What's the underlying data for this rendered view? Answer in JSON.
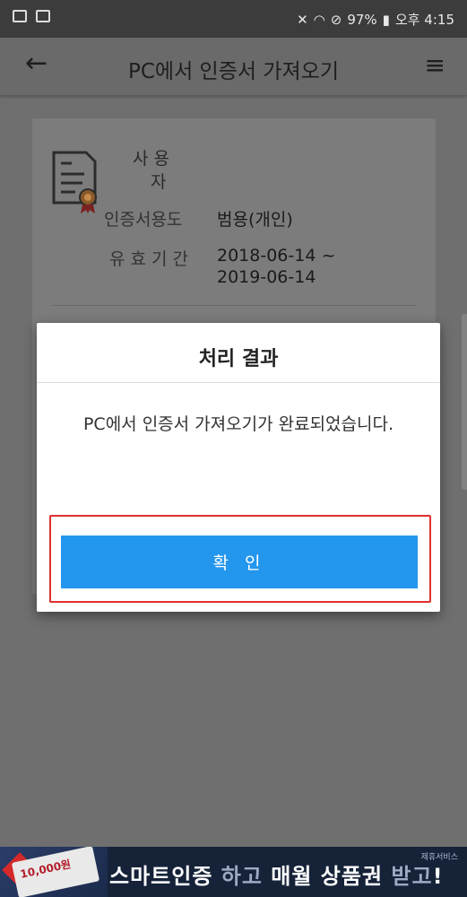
{
  "status_bar": {
    "battery": "97%",
    "time": "오후 4:15"
  },
  "app_bar": {
    "back_icon": "arrow-left",
    "title": "PC에서 인증서 가져오기",
    "menu_icon": "hamburger-menu"
  },
  "certificate": {
    "user_label_line1": "사 용",
    "user_label_line2": "자",
    "usage_label": "인증서용도",
    "usage_value": "범용(개인)",
    "validity_label": "유 효 기 간",
    "validity_line1": "2018-06-14 ~",
    "validity_line2": "2019-06-14"
  },
  "dialog": {
    "title": "처리 결과",
    "message": "PC에서 인증서 가져오기가 완료되었습니다.",
    "confirm_label": "확 인"
  },
  "banner": {
    "coupon_value": "10,000원",
    "text_bright1": "스마트인증",
    "text_dim1": "하고",
    "text_bright2": "매월 상품권",
    "text_dim2": "받고",
    "text_end": "!",
    "provider_label": "제휴서비스"
  },
  "colors": {
    "accent": "#2396ee",
    "highlight_border": "#e03030",
    "banner_bg": "#152238"
  }
}
